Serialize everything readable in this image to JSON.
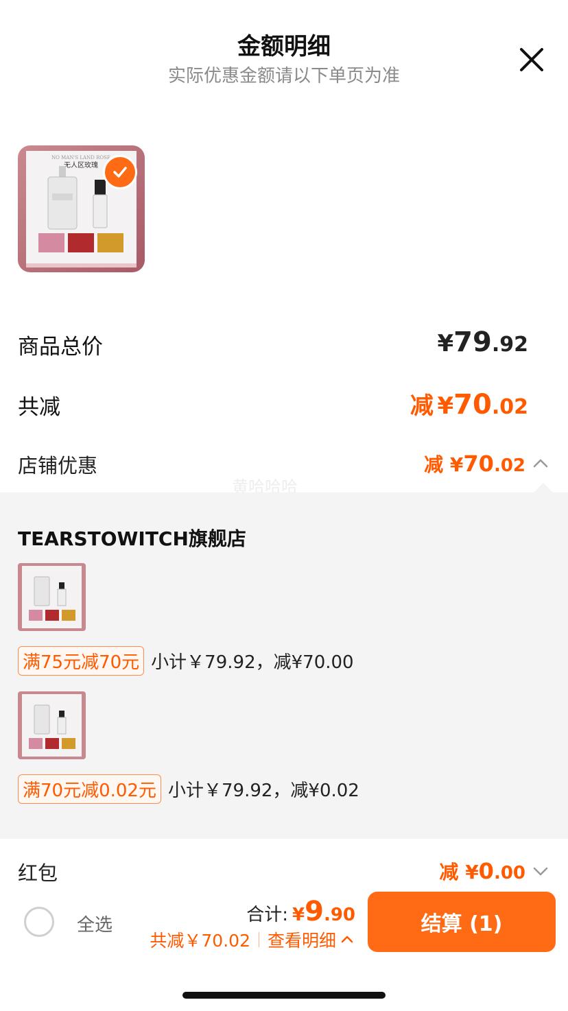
{
  "header": {
    "title": "金额明细",
    "subtitle": "实际优惠金额请以下单页为准"
  },
  "product": {
    "image_label": "无人区玫瑰",
    "image_sublabel": "NO MAN'S LAND ROSE"
  },
  "summary": {
    "total_label": "商品总价",
    "total_yen": "¥",
    "total_int": "79",
    "total_dec": ".92",
    "discount_label": "共减",
    "discount_prefix": "减",
    "discount_yen": "¥",
    "discount_int": "70",
    "discount_dec": ".02",
    "shop_label": "店铺优惠",
    "shop_prefix": "减",
    "shop_yen": "¥",
    "shop_int": "70",
    "shop_dec": ".02"
  },
  "watermark": "黄哈哈哈",
  "store": {
    "name": "TEARSTOWITCH旗舰店",
    "promos": [
      {
        "tag": "满75元减70元",
        "text": "小计￥79.92，减¥70.00"
      },
      {
        "tag": "满70元减0.02元",
        "text": "小计￥79.92，减¥0.02"
      }
    ]
  },
  "red_packet": {
    "label": "红包",
    "prefix": "减",
    "yen": "¥",
    "int": "0",
    "dec": ".00"
  },
  "bottom_bar": {
    "select_all": "全选",
    "total_label": "合计:",
    "total_yen": "¥",
    "total_int": "9",
    "total_dec": ".90",
    "discount_text": "共减￥70.02",
    "view_detail": "查看明细",
    "checkout": "结算 (1)"
  },
  "colors": {
    "accent": "#ff6a14",
    "discount": "#ff5a00",
    "panel_bg": "#f4f4f4"
  }
}
